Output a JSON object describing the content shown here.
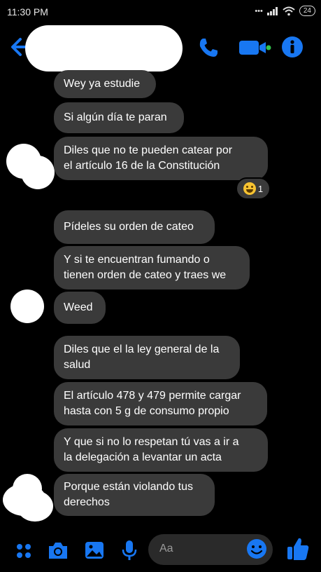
{
  "status_bar": {
    "time": "11:30 PM",
    "battery": "24"
  },
  "header": {
    "contact_name": ""
  },
  "messages": [
    {
      "lines": [
        "Wey ya estudie"
      ]
    },
    {
      "lines": [
        "Si algún día te paran"
      ]
    },
    {
      "lines": [
        "Diles que no te pueden catear por",
        "el artículo 16 de la Constitución"
      ]
    },
    {
      "lines": [
        "Pídeles su orden de cateo"
      ]
    },
    {
      "lines": [
        "Y si te encuentran fumando o",
        "tienen orden de cateo y traes we"
      ]
    },
    {
      "lines": [
        "Weed"
      ]
    },
    {
      "lines": [
        "Diles que el la ley general de la",
        "salud"
      ]
    },
    {
      "lines": [
        "El artículo 478 y 479 permite cargar",
        "hasta con 5 g de consumo propio"
      ]
    },
    {
      "lines": [
        "Y que si no lo respetan tú vas a ir a",
        "la delegación a levantar un acta"
      ]
    },
    {
      "lines": [
        "Porque están violando tus",
        "derechos"
      ]
    }
  ],
  "reaction": {
    "emoji": "grinning-face",
    "count": "1"
  },
  "composer": {
    "placeholder": "Aa"
  },
  "colors": {
    "accent": "#1877f2",
    "bubble": "#3a3a3a",
    "background": "#000000"
  }
}
